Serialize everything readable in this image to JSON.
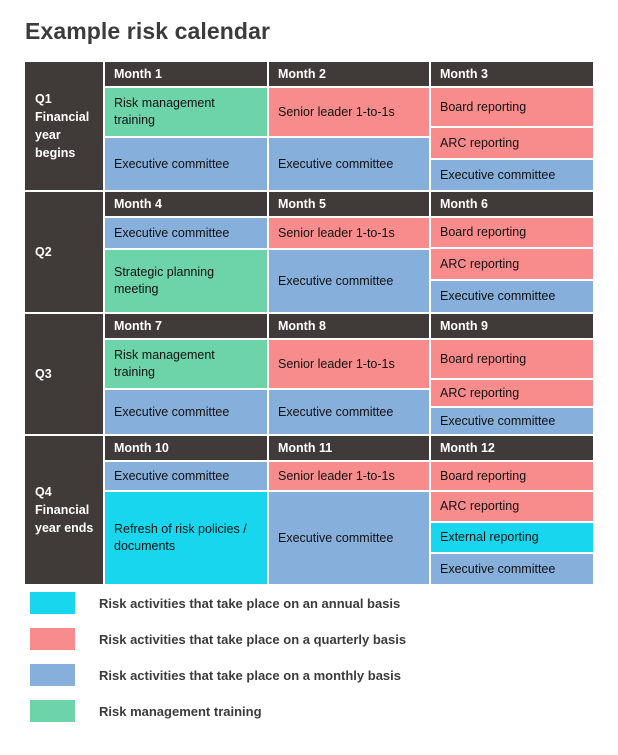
{
  "page_title": "Example risk calendar",
  "colors": {
    "annual": "#18d6ed",
    "quarterly": "#f88c8c",
    "monthly": "#86afdc",
    "training": "#6dd3a8",
    "header_dark": "#403a38",
    "grid": "#ffffff",
    "text_dark": "#3b3b3b"
  },
  "calendar": {
    "quarters": [
      {
        "label": "Q1\nFinancial\nyear\nbegins",
        "label_lines": [
          "Q1",
          "Financial",
          "year",
          "begins"
        ],
        "months": [
          {
            "header": "Month 1",
            "cells": [
              {
                "text": "Risk management training",
                "category": "training"
              },
              {
                "text": "Executive committee",
                "category": "monthly"
              }
            ]
          },
          {
            "header": "Month 2",
            "cells": [
              {
                "text": "Senior leader 1-to-1s",
                "category": "quarterly"
              },
              {
                "text": "Executive committee",
                "category": "monthly"
              }
            ]
          },
          {
            "header": "Month 3",
            "cells": [
              {
                "text": "Board reporting",
                "category": "quarterly"
              },
              {
                "text": "ARC reporting",
                "category": "quarterly"
              },
              {
                "text": "Executive committee",
                "category": "monthly"
              }
            ]
          }
        ]
      },
      {
        "label": "Q2",
        "label_lines": [
          "Q2"
        ],
        "months": [
          {
            "header": "Month 4",
            "cells": [
              {
                "text": "Executive committee",
                "category": "monthly"
              },
              {
                "text": "Strategic planning meeting",
                "category": "training"
              }
            ]
          },
          {
            "header": "Month 5",
            "cells": [
              {
                "text": "Senior leader 1-to-1s",
                "category": "quarterly"
              },
              {
                "text": "Executive committee",
                "category": "monthly"
              }
            ]
          },
          {
            "header": "Month 6",
            "cells": [
              {
                "text": "Board reporting",
                "category": "quarterly"
              },
              {
                "text": "ARC reporting",
                "category": "quarterly"
              },
              {
                "text": "Executive committee",
                "category": "monthly"
              }
            ]
          }
        ]
      },
      {
        "label": "Q3",
        "label_lines": [
          "Q3"
        ],
        "months": [
          {
            "header": "Month 7",
            "cells": [
              {
                "text": "Risk management training",
                "category": "training"
              },
              {
                "text": "Executive committee",
                "category": "monthly"
              }
            ]
          },
          {
            "header": "Month 8",
            "cells": [
              {
                "text": "Senior leader 1-to-1s",
                "category": "quarterly"
              },
              {
                "text": "Executive committee",
                "category": "monthly"
              }
            ]
          },
          {
            "header": "Month 9",
            "cells": [
              {
                "text": "Board reporting",
                "category": "quarterly"
              },
              {
                "text": "ARC reporting",
                "category": "quarterly"
              },
              {
                "text": "Executive committee",
                "category": "monthly"
              }
            ]
          }
        ]
      },
      {
        "label": "Q4\nFinancial\nyear ends",
        "label_lines": [
          "Q4",
          "Financial",
          "year ends"
        ],
        "months": [
          {
            "header": "Month 10",
            "cells": [
              {
                "text": "Executive committee",
                "category": "monthly"
              },
              {
                "text": "Refresh of risk policies / documents",
                "category": "annual"
              }
            ]
          },
          {
            "header": "Month 11",
            "cells": [
              {
                "text": "Senior leader 1-to-1s",
                "category": "quarterly"
              },
              {
                "text": "Executive committee",
                "category": "monthly"
              }
            ]
          },
          {
            "header": "Month 12",
            "cells": [
              {
                "text": "Board reporting",
                "category": "quarterly"
              },
              {
                "text": "ARC reporting",
                "category": "quarterly"
              },
              {
                "text": "External reporting",
                "category": "annual"
              },
              {
                "text": "Executive committee",
                "category": "monthly"
              }
            ]
          }
        ]
      }
    ]
  },
  "legend": {
    "items": [
      {
        "category": "annual",
        "label": "Risk activities that take place on an annual basis"
      },
      {
        "category": "quarterly",
        "label": "Risk activities that take place on a quarterly basis"
      },
      {
        "category": "monthly",
        "label": "Risk activities that take place on a monthly basis"
      },
      {
        "category": "training",
        "label": "Risk management training"
      }
    ]
  }
}
